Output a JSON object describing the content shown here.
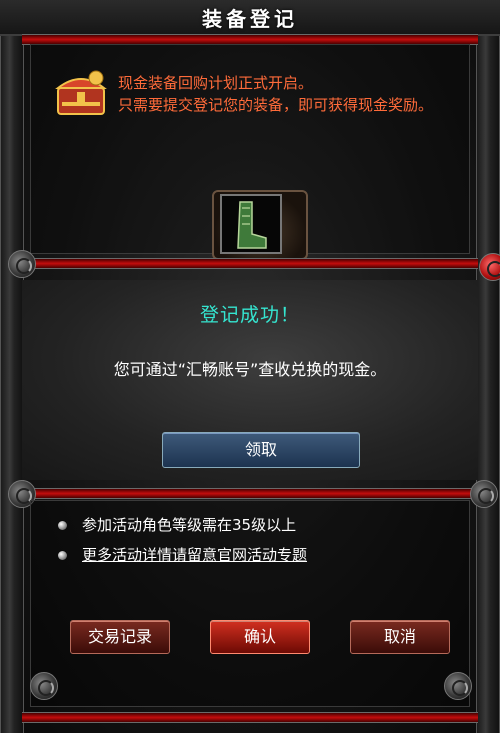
{
  "window": {
    "title": "装备登记"
  },
  "top_panel": {
    "notice_line1": "现金装备回购计划正式开启。",
    "notice_line2": "只需要提交登记您的装备，即可获得现金奖励。"
  },
  "modal": {
    "title": "登记成功！",
    "message": "您可通过“汇畅账号”查收兑换的现金。",
    "claim_label": "领取"
  },
  "rules": [
    {
      "text": "参加活动角色等级需在35级以上"
    },
    {
      "text": "更多活动详情请留意官网活动专题"
    }
  ],
  "buttons": {
    "history_label": "交易记录",
    "confirm_label": "确认",
    "cancel_label": "取消"
  },
  "colors": {
    "accent_red": "#c40d0d",
    "title_teal": "#35e5d0",
    "notice_orange": "#ff6b3a"
  }
}
